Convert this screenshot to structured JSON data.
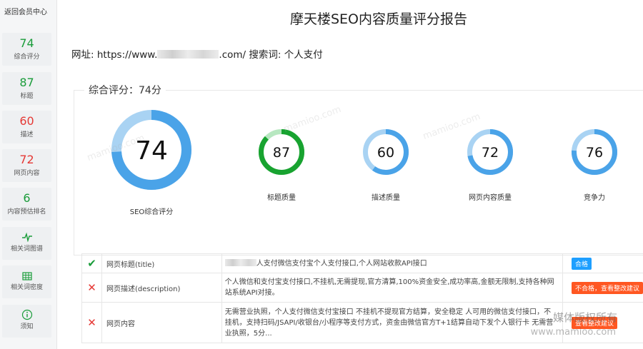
{
  "sidebar": {
    "back_label": "返回会员中心",
    "items": [
      {
        "value": "74",
        "label": "综合评分",
        "color": "#1a9c3a"
      },
      {
        "value": "87",
        "label": "标题",
        "color": "#1a9c3a"
      },
      {
        "value": "60",
        "label": "描述",
        "color": "#e53935"
      },
      {
        "value": "72",
        "label": "网页内容",
        "color": "#e53935"
      },
      {
        "value": "6",
        "label": "内容预估排名",
        "color": "#1a9c3a"
      },
      {
        "icon": "pulse-icon",
        "label": "相关词图谱"
      },
      {
        "icon": "grid-icon",
        "label": "相关词密度"
      },
      {
        "icon": "info-icon",
        "label": "须知"
      }
    ]
  },
  "header": {
    "title": "摩天楼SEO内容质量评分报告",
    "url_prefix": "网址: https://www.",
    "url_suffix": ".com/ 搜索词: 个人支付"
  },
  "overview": {
    "legend": "综合评分：74分",
    "gauges": [
      {
        "value": 74,
        "label": "SEO综合评分",
        "color": "#4aa3e8"
      },
      {
        "value": 87,
        "label": "标题质量",
        "color": "#18a330"
      },
      {
        "value": 60,
        "label": "描述质量",
        "color": "#4aa3e8"
      },
      {
        "value": 72,
        "label": "网页内容质量",
        "color": "#4aa3e8"
      },
      {
        "value": 76,
        "label": "竞争力",
        "color": "#4aa3e8"
      }
    ]
  },
  "checks": [
    {
      "status": "pass",
      "name": "网页标题(title)",
      "desc": "人支付微信支付宝个人支付接口,个人网站收款API接口",
      "badge": "合格"
    },
    {
      "status": "fail",
      "name": "网页描述(description)",
      "desc": "个人微信和支付宝支付接口,不挂机,无需提现,官方清算,100%资金安全,成功率高,金额无限制,支持各种网站系统API对接。",
      "badge": "不合格，查看整改建议"
    },
    {
      "status": "fail",
      "name": "网页内容",
      "desc": "无需营业执照，个人支付微信支付宝接口 不挂机不提现官方结算，安全稳定 人可用的微信支付接口，不挂机，支持扫码/JSAPI/收银台/小程序等支付方式，资金由微信官方T+1结算自动下发个人银行卡 无需营业执照，5分...",
      "badge": "查看整改建议"
    }
  ],
  "watermark": {
    "site": "mamioo.com",
    "line1": "媒体版权所有",
    "line2": "www.mamioo.com"
  }
}
